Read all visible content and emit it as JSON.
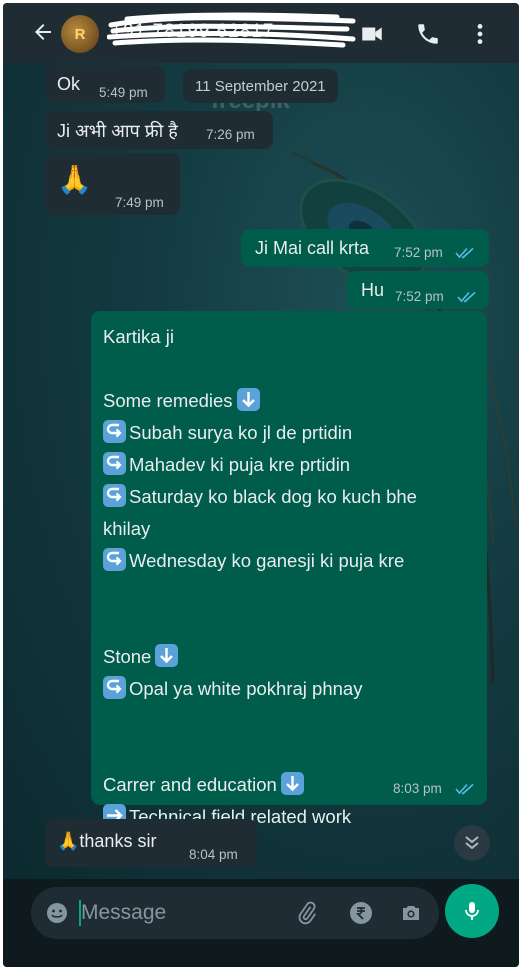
{
  "header": {
    "contact_name": "+91 78199 62817",
    "avatar_initials": "R"
  },
  "chat": {
    "date_separator": "11 September 2021",
    "watermark": "freepik",
    "messages": [
      {
        "direction": "incoming",
        "text": "Ok",
        "time": "5:49 pm"
      },
      {
        "direction": "incoming",
        "text": "Ji अभी आप फ्री है",
        "time": "7:26 pm"
      },
      {
        "direction": "incoming",
        "text": "🙏",
        "time": "7:49 pm"
      },
      {
        "direction": "outgoing",
        "text": "Ji Mai call krta",
        "time": "7:52 pm",
        "read": true
      },
      {
        "direction": "outgoing",
        "text": "Hu",
        "time": "7:52 pm",
        "read": true
      },
      {
        "direction": "outgoing",
        "time": "8:03 pm",
        "read": true,
        "lines": [
          {
            "icon": "",
            "text": "Kartika  ji"
          },
          {
            "icon": "",
            "text": ""
          },
          {
            "icon": "",
            "text": "Some remedies",
            "trailing_icon": "down-arrow-emoji"
          },
          {
            "icon": "return-arrow-emoji",
            "text": "Subah surya ko jl de prtidin"
          },
          {
            "icon": "return-arrow-emoji",
            "text": "Mahadev ki puja kre prtidin"
          },
          {
            "icon": "return-arrow-emoji",
            "text": "Saturday ko black dog ko kuch bhe"
          },
          {
            "icon": "",
            "text": "khilay"
          },
          {
            "icon": "return-arrow-emoji",
            "text": "Wednesday ko ganesji ki puja kre"
          },
          {
            "icon": "",
            "text": ""
          },
          {
            "icon": "",
            "text": ""
          },
          {
            "icon": "",
            "text": "Stone",
            "trailing_icon": "down-arrow-emoji"
          },
          {
            "icon": "return-arrow-emoji",
            "text": "Opal ya white pokhraj phnay"
          },
          {
            "icon": "",
            "text": ""
          },
          {
            "icon": "",
            "text": ""
          },
          {
            "icon": "",
            "text": "Carrer and education",
            "trailing_icon": "down-arrow-emoji"
          },
          {
            "icon": "right-arrow-emoji",
            "text": "Technical field related work"
          }
        ]
      },
      {
        "direction": "incoming",
        "text": "🙏thanks sir",
        "time": "8:04 pm"
      }
    ]
  },
  "input": {
    "placeholder": "Message"
  },
  "colors": {
    "header_bg": "#1f2c33",
    "incoming_bubble": "#1f2c33",
    "outgoing_bubble": "#005c4b",
    "accent": "#00a884",
    "read_ticks": "#53bdeb"
  },
  "icons": {
    "header": [
      "back-arrow-icon",
      "video-call-icon",
      "voice-call-icon",
      "more-options-icon"
    ],
    "input": [
      "emoji-icon",
      "attach-icon",
      "rupee-payment-icon",
      "camera-icon",
      "mic-icon"
    ],
    "scroll": "double-chevron-down-icon"
  }
}
